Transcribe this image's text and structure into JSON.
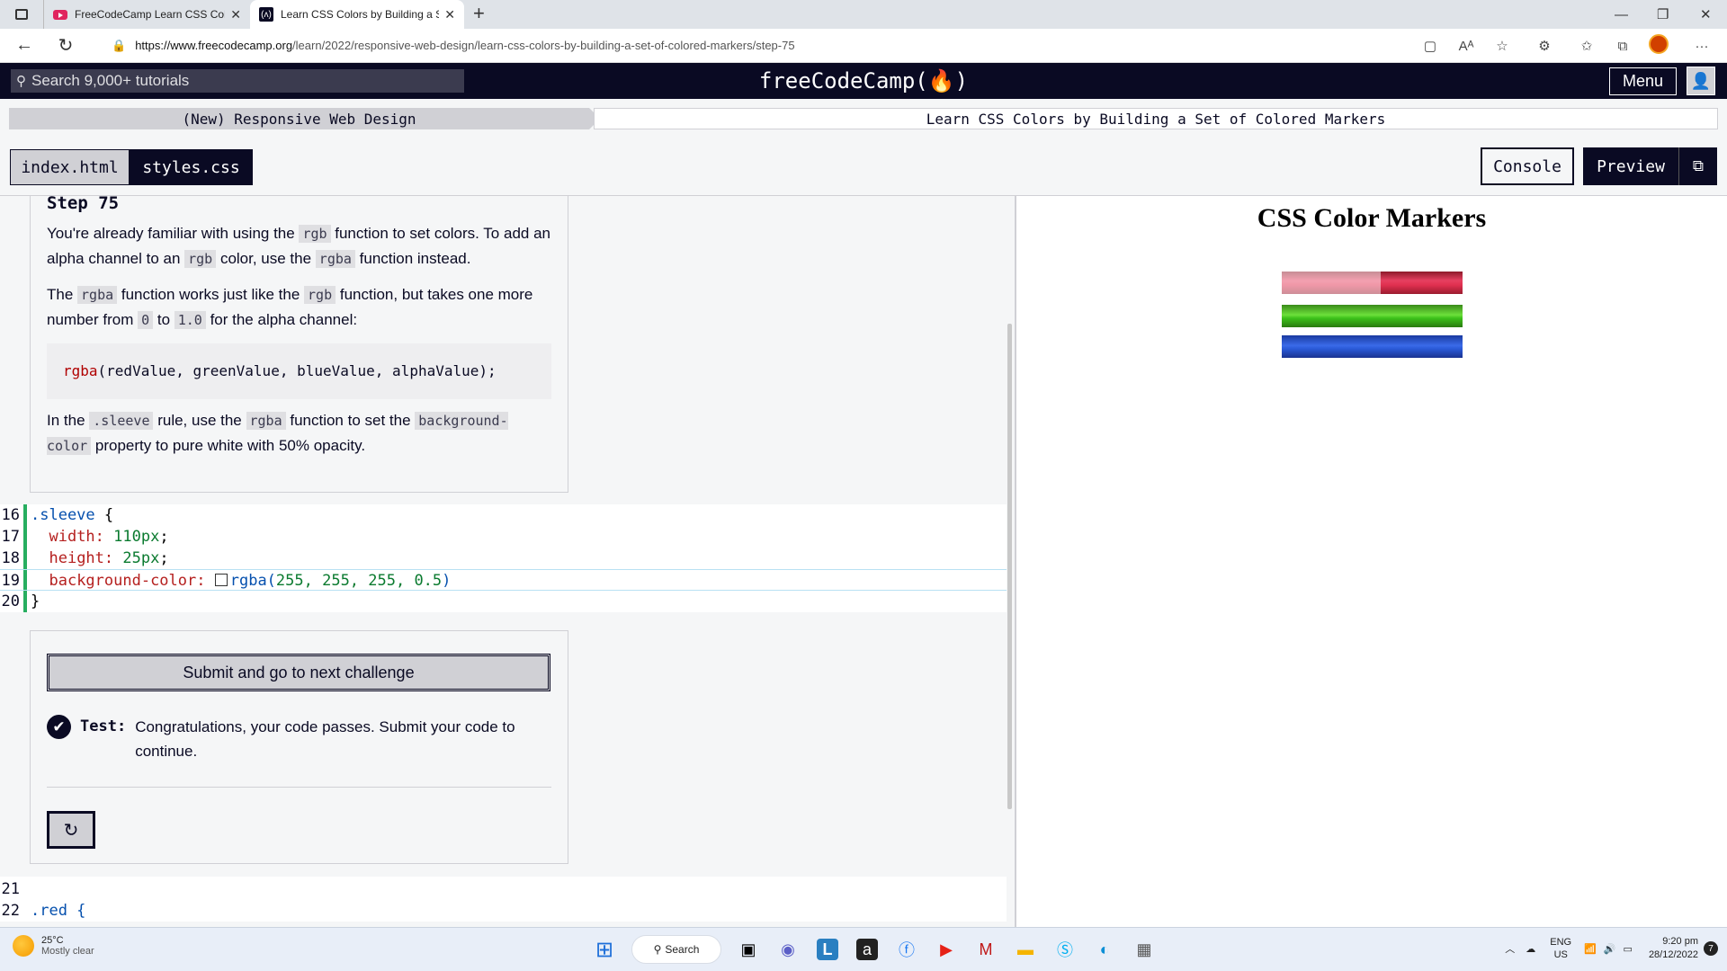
{
  "browser": {
    "tabs": [
      {
        "title": "FreeCodeCamp Learn CSS Colors"
      },
      {
        "title": "Learn CSS Colors by Building a S"
      }
    ],
    "new_tab_symbol": "+",
    "url_host": "https://www.freecodecamp.org",
    "url_path": "/learn/2022/responsive-web-design/learn-css-colors-by-building-a-set-of-colored-markers/step-75"
  },
  "fcc_nav": {
    "search_placeholder": "Search 9,000+ tutorials",
    "logo": "freeCodeCamp(🔥)",
    "menu_label": "Menu"
  },
  "breadcrumb": {
    "superblock": "(New) Responsive Web Design",
    "block": "Learn CSS Colors by Building a Set of Colored Markers"
  },
  "toolbar": {
    "file_tabs": [
      "index.html",
      "styles.css"
    ],
    "console_label": "Console",
    "preview_label": "Preview"
  },
  "step": {
    "title": "Step 75",
    "p1": [
      "You're already familiar with using the ",
      "rgb",
      " function to set colors. To add an alpha channel to an ",
      "rgb",
      " color, use the ",
      "rgba",
      " function instead."
    ],
    "p2": [
      "The ",
      "rgba",
      " function works just like the ",
      "rgb",
      " function, but takes one more number from ",
      "0",
      " to ",
      "1.0",
      " for the alpha channel:"
    ],
    "code_fn": "rgba",
    "code_args": "(redValue, greenValue, blueValue, alphaValue);",
    "p3": [
      "In the ",
      ".sleeve",
      " rule, use the ",
      "rgba",
      " function to set the ",
      "background-color",
      " property to pure white with 50% opacity."
    ]
  },
  "code": {
    "lines": [
      {
        "n": "16",
        "selector": ".sleeve",
        "rest": " {"
      },
      {
        "n": "17",
        "prop": "width:",
        "val": " 110px",
        "end": ";"
      },
      {
        "n": "18",
        "prop": "height:",
        "val": " 25px",
        "end": ";"
      },
      {
        "n": "19",
        "prop": "background-color:",
        "fn": "rgba(",
        "args": "255, 255, 255, 0.5",
        "close": ")"
      },
      {
        "n": "20",
        "text": "}"
      }
    ],
    "after_lines": [
      {
        "n": "21",
        "text": ""
      },
      {
        "n": "22",
        "text": ".red {"
      }
    ]
  },
  "test_panel": {
    "submit_label": "Submit and go to next challenge",
    "test_label": "Test:",
    "test_message": "Congratulations, your code passes. Submit your code to continue.",
    "reset_icon": "refresh-icon"
  },
  "preview": {
    "title": "CSS Color Markers",
    "markers": [
      {
        "name": "red",
        "color": "#e03050"
      },
      {
        "name": "green",
        "color": "#3cc01a"
      },
      {
        "name": "blue",
        "color": "#2a5ad8"
      }
    ]
  },
  "taskbar": {
    "temp": "25°C",
    "condition": "Mostly clear",
    "search_label": "Search",
    "lang1": "ENG",
    "lang2": "US",
    "time": "9:20 pm",
    "date": "28/12/2022",
    "notifications": "7"
  }
}
